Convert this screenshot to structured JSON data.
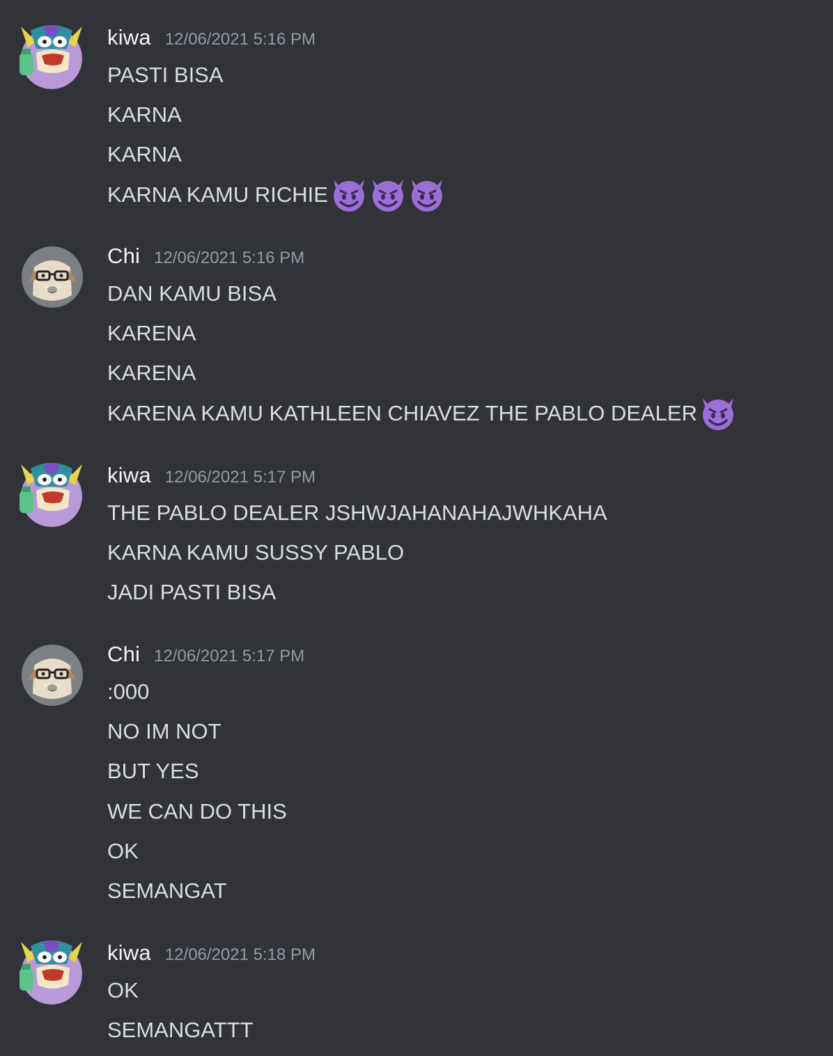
{
  "groups": [
    {
      "author": "kiwa",
      "timestamp": "12/06/2021 5:16 PM",
      "avatar": "owl-avatar",
      "messages": [
        {
          "text": "PASTI BISA",
          "emojis": []
        },
        {
          "text": "KARNA",
          "emojis": []
        },
        {
          "text": "KARNA",
          "emojis": []
        },
        {
          "text": "KARNA KAMU RICHIE",
          "emojis": [
            "smiling-imp-emoji",
            "smiling-imp-emoji",
            "smiling-imp-emoji"
          ]
        }
      ]
    },
    {
      "author": "Chi",
      "timestamp": "12/06/2021 5:16 PM",
      "avatar": "dog-with-glasses-avatar",
      "messages": [
        {
          "text": "DAN KAMU BISA",
          "emojis": []
        },
        {
          "text": "KARENA",
          "emojis": []
        },
        {
          "text": "KARENA",
          "emojis": []
        },
        {
          "text": "KARENA KAMU KATHLEEN CHIAVEZ THE PABLO DEALER",
          "emojis": [
            "smiling-imp-emoji"
          ]
        }
      ]
    },
    {
      "author": "kiwa",
      "timestamp": "12/06/2021 5:17 PM",
      "avatar": "owl-avatar",
      "messages": [
        {
          "text": "THE PABLO DEALER JSHWJAHANAHAJWHKAHA",
          "emojis": []
        },
        {
          "text": "KARNA KAMU SUSSY PABLO",
          "emojis": []
        },
        {
          "text": "JADI PASTI BISA",
          "emojis": []
        }
      ]
    },
    {
      "author": "Chi",
      "timestamp": "12/06/2021 5:17 PM",
      "avatar": "dog-with-glasses-avatar",
      "messages": [
        {
          "text": ":000",
          "emojis": []
        },
        {
          "text": "NO IM NOT",
          "emojis": []
        },
        {
          "text": "BUT YES",
          "emojis": []
        },
        {
          "text": "WE CAN DO THIS",
          "emojis": []
        },
        {
          "text": "OK",
          "emojis": []
        },
        {
          "text": "SEMANGAT",
          "emojis": []
        }
      ]
    },
    {
      "author": "kiwa",
      "timestamp": "12/06/2021 5:18 PM",
      "avatar": "owl-avatar",
      "messages": [
        {
          "text": "OK",
          "emojis": []
        },
        {
          "text": "SEMANGATTT",
          "emojis": []
        }
      ]
    }
  ],
  "colors": {
    "background": "#313338",
    "username": "#f2f3f5",
    "timestamp": "#949ba4",
    "message": "#dbdee1",
    "emoji": "#9b6fd6"
  }
}
